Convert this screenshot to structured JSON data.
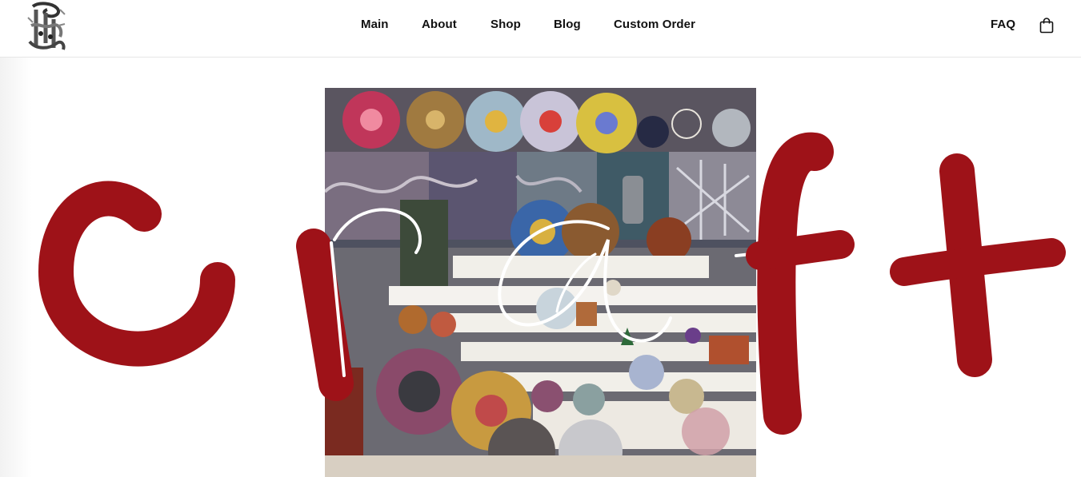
{
  "header": {
    "logo_icon": "ornate-letter-logo",
    "nav_items": [
      {
        "label": "Main"
      },
      {
        "label": "About"
      },
      {
        "label": "Shop"
      },
      {
        "label": "Blog"
      },
      {
        "label": "Custom Order"
      }
    ],
    "faq_label": "FAQ",
    "cart_icon": "shopping-bag-icon"
  },
  "hero": {
    "title": "craft",
    "title_color": "#9e1218",
    "outline_color": "#ffffff",
    "image_icon": "resin-art-studio-photo"
  }
}
